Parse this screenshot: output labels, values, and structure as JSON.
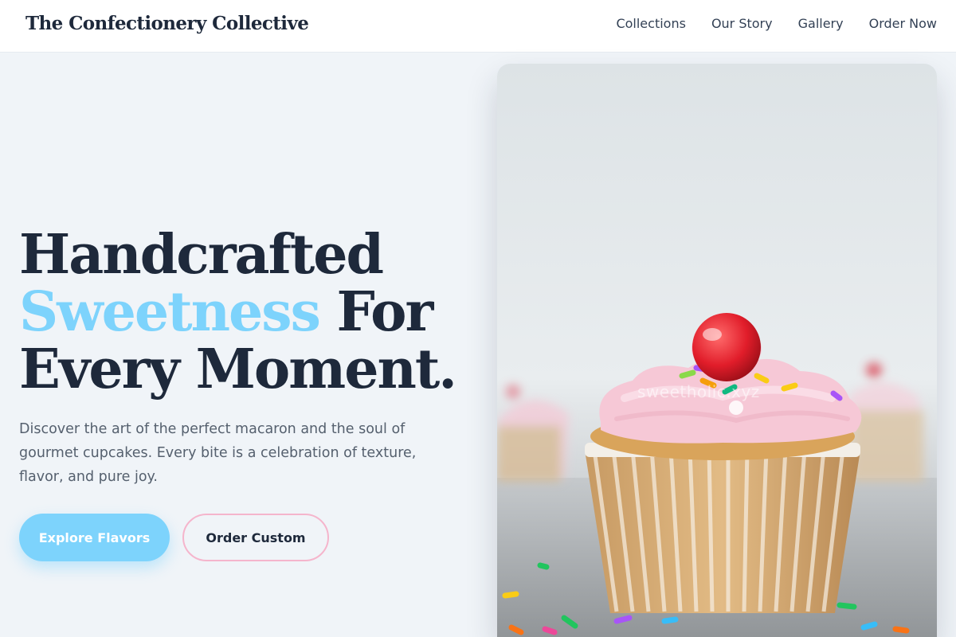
{
  "header": {
    "brand": "The Confectionery Collective",
    "nav": [
      "Collections",
      "Our Story",
      "Gallery",
      "Order Now"
    ]
  },
  "hero": {
    "title_line1": "Handcrafted",
    "title_line2_accent": "Sweetness",
    "title_line2_rest": " For",
    "title_line3": "Every Moment.",
    "description": "Discover the art of the perfect macaron and the soul of gourmet cupcakes. Every bite is a celebration of texture, flavor, and pure joy.",
    "primary_button": "Explore Flavors",
    "secondary_button": "Order Custom"
  },
  "image": {
    "subject": "cupcake-with-pink-frosting-and-cherry",
    "watermark": "sweetholic.xyz"
  },
  "colors": {
    "accent": "#7dd3fc",
    "dark": "#1e293b",
    "pink_outline": "#f5b5cc",
    "background": "#f0f4f8"
  }
}
